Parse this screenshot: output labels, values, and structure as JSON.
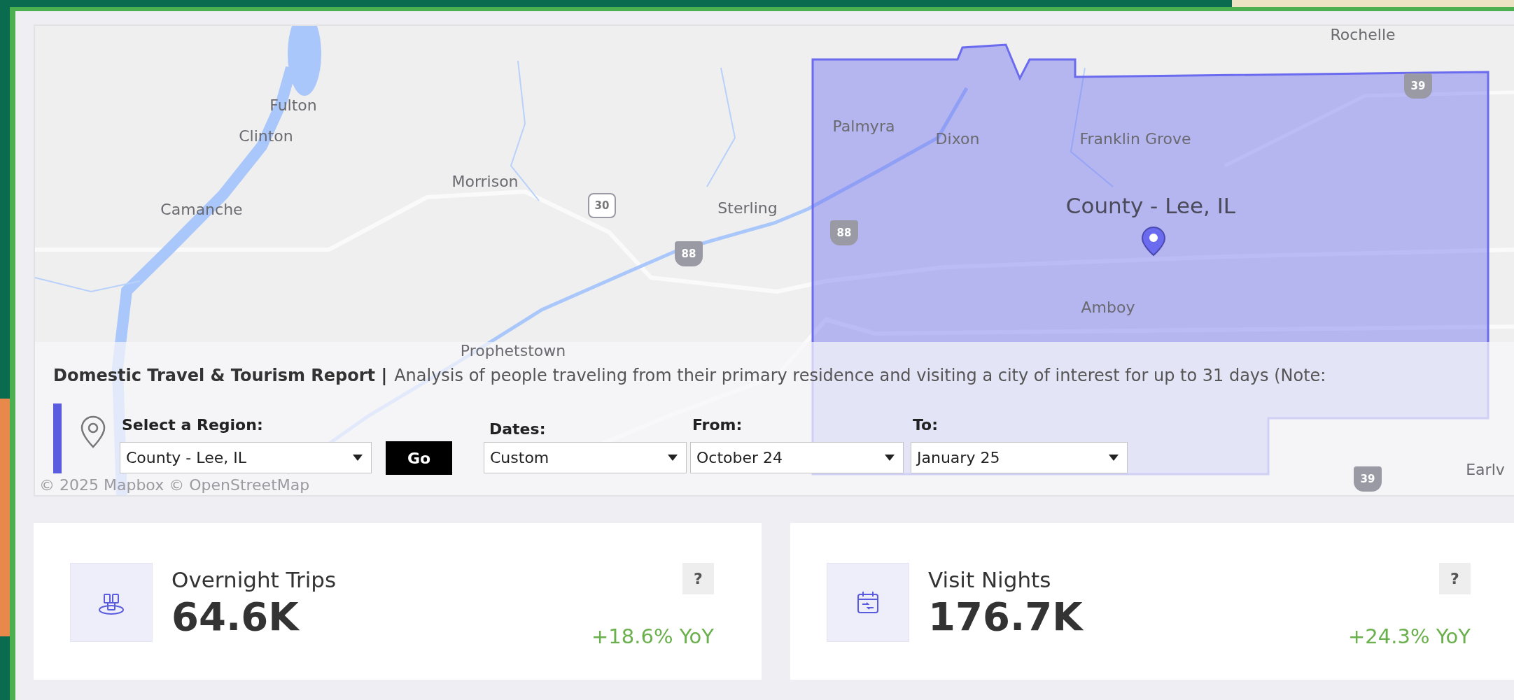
{
  "map": {
    "labels": [
      {
        "kind": "city",
        "text": "Rochelle"
      },
      {
        "kind": "city",
        "text": "Fulton"
      },
      {
        "kind": "city",
        "text": "Clinton"
      },
      {
        "kind": "city",
        "text": "Palmyra"
      },
      {
        "kind": "city",
        "text": "Dixon"
      },
      {
        "kind": "city",
        "text": "Franklin Grove"
      },
      {
        "kind": "city",
        "text": "Morrison"
      },
      {
        "kind": "city",
        "text": "Camanche"
      },
      {
        "kind": "city",
        "text": "Sterling"
      },
      {
        "kind": "region",
        "text": "County - Lee, IL"
      },
      {
        "kind": "city",
        "text": "Amboy"
      },
      {
        "kind": "city",
        "text": "Prophetstown"
      },
      {
        "kind": "city",
        "text": "Earlv"
      }
    ],
    "road_shields": [
      {
        "kind": "interstate",
        "text": "39"
      },
      {
        "kind": "us",
        "text": "30"
      },
      {
        "kind": "interstate",
        "text": "88"
      },
      {
        "kind": "interstate",
        "text": "88"
      },
      {
        "kind": "interstate",
        "text": "39"
      }
    ],
    "attribution": "© 2025 Mapbox © OpenStreetMap"
  },
  "report": {
    "title": "Domestic Travel & Tourism Report |",
    "description": "Analysis of people traveling from their primary residence and visiting a city of interest for up to 31 days (Note:"
  },
  "filters": [
    {
      "kind": "region",
      "label": "Select a Region:",
      "value": "County - Lee, IL"
    },
    {
      "kind": "date",
      "label": "Dates:",
      "value": "Custom"
    },
    {
      "kind": "date",
      "label": "From:",
      "value": "October 24"
    },
    {
      "kind": "date",
      "label": "To:",
      "value": "January 25"
    }
  ],
  "go_button": "Go",
  "metrics": [
    {
      "kind": "trips",
      "title": "Overnight Trips",
      "value": "64.6K",
      "change": "+18.6% YoY",
      "help": "?"
    },
    {
      "kind": "nights",
      "title": "Visit Nights",
      "value": "176.7K",
      "change": "+24.3% YoY",
      "help": "?"
    }
  ]
}
